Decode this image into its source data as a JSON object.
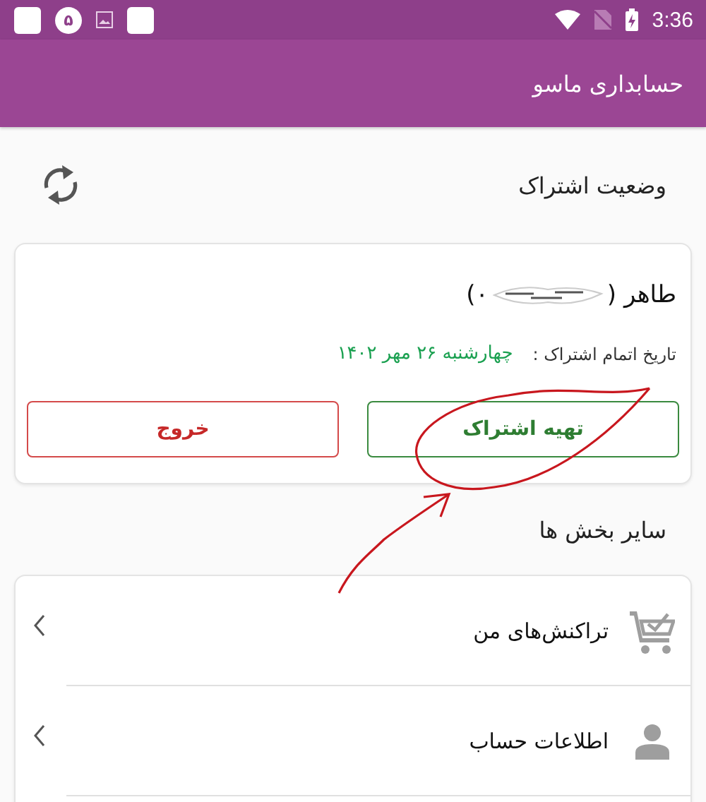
{
  "status_bar": {
    "notification_badge": "۵",
    "time": "3:36"
  },
  "app_bar": {
    "title": "حسابداری ماسو"
  },
  "subscription": {
    "title": "وضعیت اشتراک",
    "name_start": "طاهر (",
    "name_end": "۰)",
    "expiry_label": "تاریخ اتمام اشتراک :",
    "expiry_date": "چهارشنبه ۲۶ مهر ۱۴۰۲",
    "buttons": [
      {
        "label": "تهیه اشتراک",
        "kind": "primary"
      },
      {
        "label": "خروج",
        "kind": "danger"
      }
    ]
  },
  "other_sections": {
    "title": "سایر بخش ها",
    "items": [
      {
        "label": "تراکنش‌های من",
        "kind": "cart"
      },
      {
        "label": "اطلاعات حساب",
        "kind": "person"
      }
    ]
  }
}
